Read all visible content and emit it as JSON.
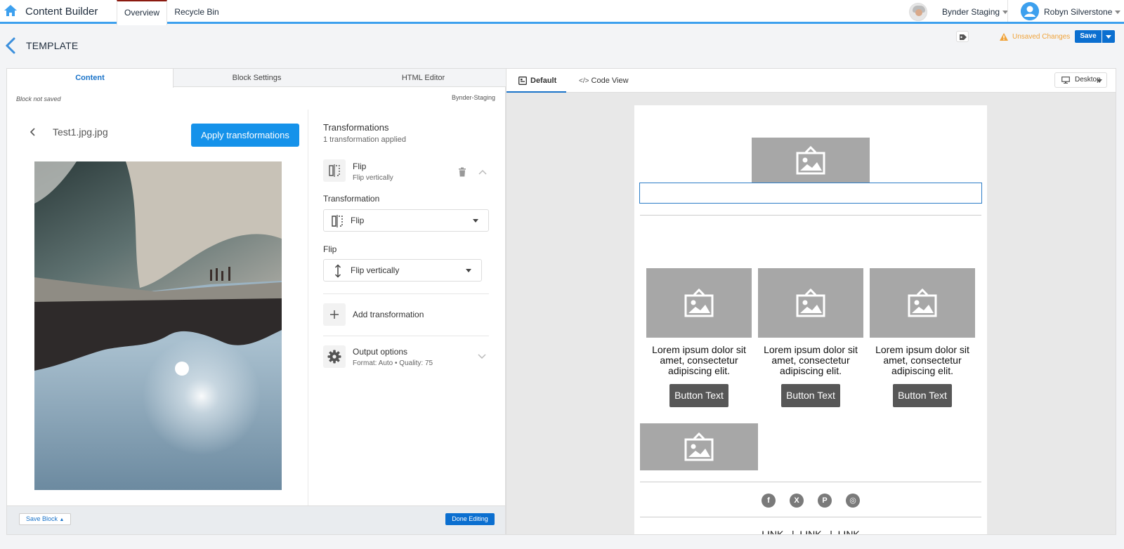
{
  "nav": {
    "app_title": "Content Builder",
    "tabs": [
      {
        "label": "Overview",
        "active": true
      },
      {
        "label": "Recycle Bin",
        "active": false
      }
    ],
    "org": "Bynder Staging",
    "user": "Robyn Silverstone"
  },
  "header": {
    "title": "TEMPLATE",
    "unsaved": "Unsaved Changes",
    "save_label": "Save"
  },
  "left": {
    "tabs": [
      "Content",
      "Block Settings",
      "HTML Editor"
    ],
    "block_status": "Block not saved",
    "source": "Bynder-Staging",
    "file_name": "Test1.jpg.jpg",
    "apply_label": "Apply transformations",
    "transformations": {
      "heading": "Transformations",
      "count_text": "1 transformation applied",
      "item_name": "Flip",
      "item_sub": "Flip vertically",
      "type_label": "Transformation",
      "type_value": "Flip",
      "flip_label": "Flip",
      "flip_value": "Flip vertically",
      "add_label": "Add transformation",
      "output_title": "Output options",
      "output_sub": "Format: Auto • Quality: 75"
    },
    "footer": {
      "save_block": "Save Block",
      "done": "Done Editing"
    }
  },
  "right": {
    "tabs": [
      "Default",
      "Code View"
    ],
    "device": "Desktop",
    "columns": [
      {
        "text": "Lorem ipsum dolor sit amet, consectetur adipiscing elit.",
        "button": "Button Text"
      },
      {
        "text": "Lorem ipsum dolor sit amet, consectetur adipiscing elit.",
        "button": "Button Text"
      },
      {
        "text": "Lorem ipsum dolor sit amet, consectetur adipiscing elit.",
        "button": "Button Text"
      }
    ],
    "social_icons": [
      "facebook-icon",
      "x-icon",
      "pinterest-icon",
      "instagram-icon"
    ],
    "social_glyphs": [
      "f",
      "X",
      "P",
      "◎"
    ],
    "links": "LINK   |  LINK   |  LINK"
  },
  "colors": {
    "accent": "#1592ea",
    "brand_blue": "#0b6fd0",
    "warning": "#f0a33a",
    "placeholder": "#a7a7a7"
  }
}
